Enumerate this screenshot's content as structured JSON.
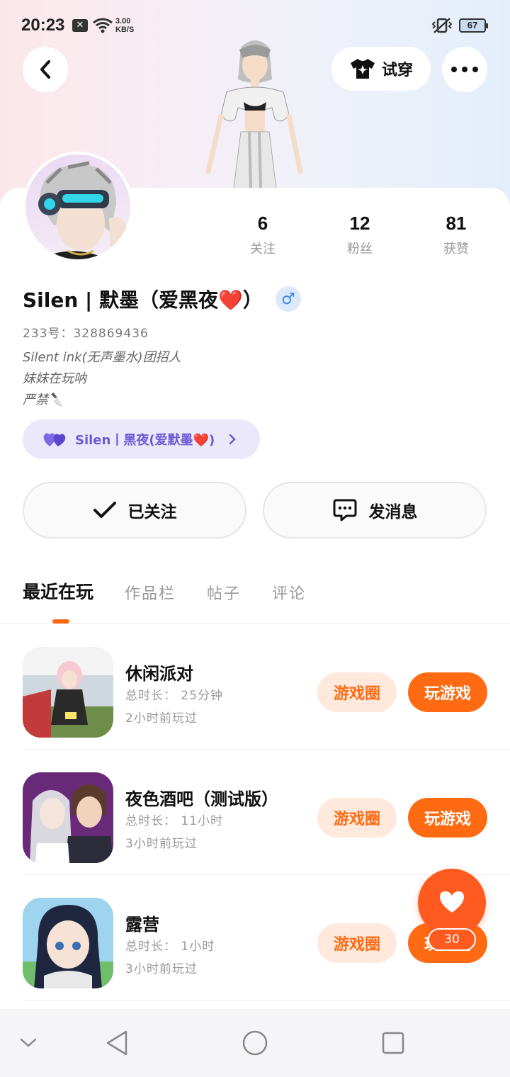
{
  "status_bar": {
    "time": "20:23",
    "speed_value": "3.00",
    "speed_unit": "KB/S",
    "battery": "67"
  },
  "header": {
    "try_on_label": "试穿"
  },
  "profile": {
    "stats": [
      {
        "value": "6",
        "label": "关注"
      },
      {
        "value": "12",
        "label": "粉丝"
      },
      {
        "value": "81",
        "label": "获赞"
      }
    ],
    "name": "Silen | 默墨（爱黑夜❤️）",
    "gender_symbol": "♂",
    "uid": "233号：328869436",
    "bio_lines": [
      "Silent ink(无声墨水)团招人",
      "妹妹在玩呐",
      "严禁🔪"
    ],
    "relation_text": "Silen丨黑夜(爱默墨❤️)"
  },
  "actions": {
    "follow_label": "已关注",
    "message_label": "发消息"
  },
  "tabs": [
    "最近在玩",
    "作品栏",
    "帖子",
    "评论"
  ],
  "games": [
    {
      "title": "休闲派对",
      "duration": "总时长： 25分钟",
      "last_played": "2小时前玩过",
      "circle_label": "游戏圈",
      "play_label": "玩游戏"
    },
    {
      "title": "夜色酒吧（测试版）",
      "duration": "总时长： 11小时",
      "last_played": "3小时前玩过",
      "circle_label": "游戏圈",
      "play_label": "玩游戏"
    },
    {
      "title": "露营",
      "duration": "总时长： 1小时",
      "last_played": "3小时前玩过",
      "circle_label": "游戏圈",
      "play_label": "玩游戏"
    }
  ],
  "fab": {
    "count": "30"
  },
  "colors": {
    "accent": "#ff6a12",
    "accent_light": "#ffe9dc",
    "relation_bg": "#ece8fb",
    "relation_text": "#6c59d4",
    "gender_blue": "#3d86e8"
  }
}
